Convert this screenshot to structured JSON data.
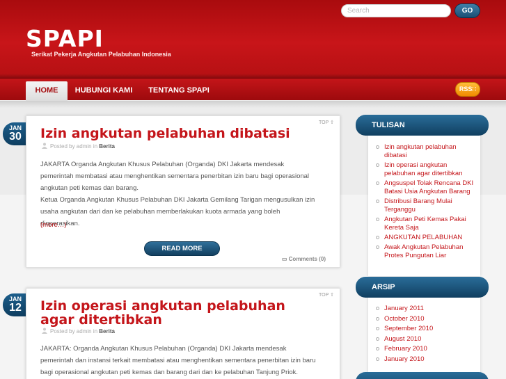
{
  "header": {
    "site_title": "SPAPI",
    "tagline": "Serikat Pekerja Angkutan Pelabuhan Indonesia",
    "search_placeholder": "Search",
    "go_label": "GO"
  },
  "nav": {
    "items": [
      {
        "label": "HOME"
      },
      {
        "label": "HUBUNGI KAMI"
      },
      {
        "label": "TENTANG SPAPI"
      }
    ],
    "rss_label": "RSS"
  },
  "posts": [
    {
      "month": "JAN",
      "day": "30",
      "title": "Izin angkutan pelabuhan dibatasi",
      "meta_prefix": "Posted by admin in",
      "category": "Berita",
      "paragraphs": [
        "JAKARTA Organda Angkutan Khusus Pelabuhan (Organda) DKI Jakarta mendesak pemerintah membatasi atau menghentikan sementara penerbitan izin baru bagi operasional angkutan peti kemas dan barang.",
        "Ketua Organda Angkutan Khusus Pelabuhan DKI Jakarta Gemilang Tarigan mengusulkan izin usaha angkutan dari dan ke pelabuhan memberlakukan kuota armada yang boleh dioperasikan."
      ],
      "more": "(more…)",
      "read_more": "READ MORE",
      "comments": "Comments (0)",
      "top": "TOP"
    },
    {
      "month": "JAN",
      "day": "12",
      "title": "Izin operasi angkutan pelabuhan agar ditertibkan",
      "meta_prefix": "Posted by admin in",
      "category": "Berita",
      "paragraphs": [
        "JAKARTA: Organda Angkutan Khusus Pelabuhan (Organda) DKI Jakarta mendesak pemerintah dan instansi terkait membatasi atau menghentikan sementara penerbitan izin baru bagi operasional angkutan peti kemas dan barang dari dan ke pelabuhan Tanjung Priok."
      ],
      "top": "TOP"
    }
  ],
  "sidebar": {
    "tulisan": {
      "heading": "TULISAN",
      "items": [
        "Izin angkutan pelabuhan dibatasi",
        "Izin operasi angkutan pelabuhan agar ditertibkan",
        "Angsuspel Tolak Rencana DKI Batasi Usia Angkutan Barang",
        "Distribusi Barang Mulai Terganggu",
        "Angkutan Peti Kemas Pakai Kereta Saja",
        "ANGKUTAN PELABUHAN",
        "Awak Angkutan Pelabuhan Protes Pungutan Liar"
      ]
    },
    "arsip": {
      "heading": "ARSIP",
      "items": [
        "January 2011",
        "October 2010",
        "September 2010",
        "August 2010",
        "February 2010",
        "January 2010"
      ]
    }
  }
}
